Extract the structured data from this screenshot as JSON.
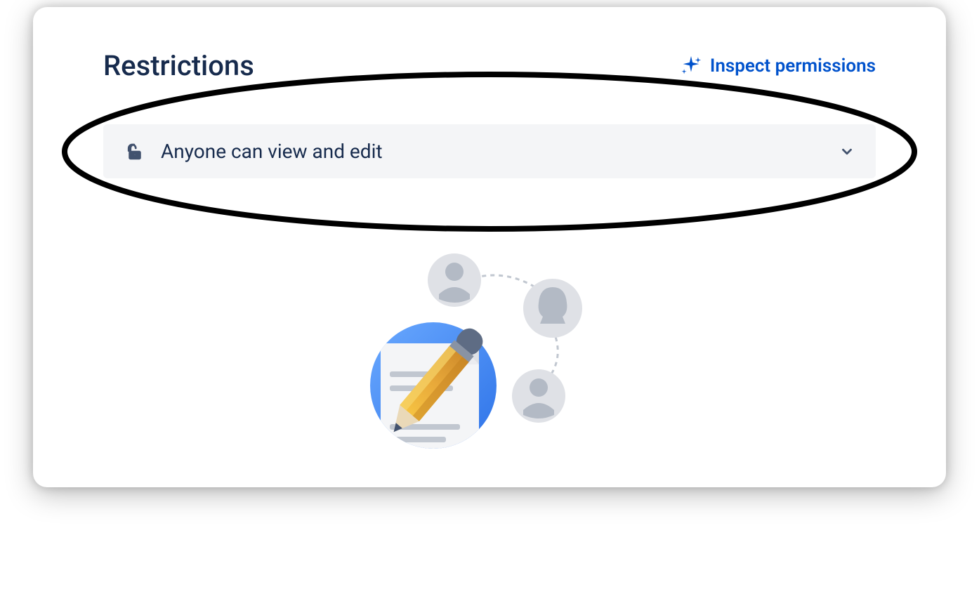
{
  "header": {
    "title": "Restrictions",
    "inspect_label": "Inspect permissions"
  },
  "dropdown": {
    "selected_label": "Anyone can view and edit"
  },
  "icons": {
    "sparkle": "sparkle-icon",
    "unlock": "unlock-icon",
    "chevron_down": "chevron-down-icon"
  },
  "colors": {
    "text_primary": "#172B4D",
    "link_blue": "#0052CC",
    "dropdown_bg": "#F4F5F7",
    "icon_gray": "#42526E"
  }
}
